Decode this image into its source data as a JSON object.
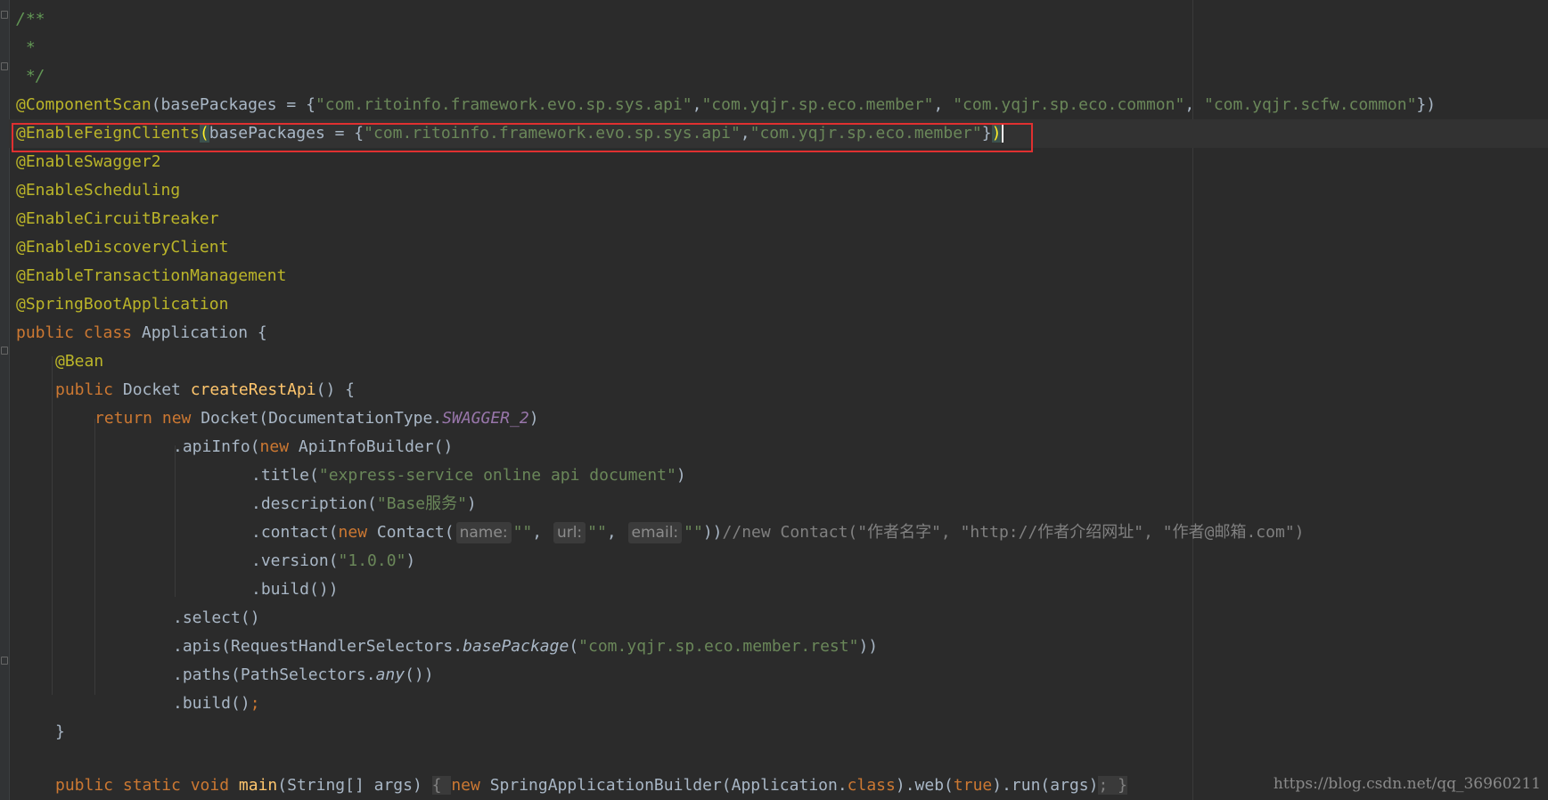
{
  "editor": {
    "watermark": "https://blog.csdn.net/qq_36960211"
  },
  "code": {
    "l1": "/**",
    "l2": " *",
    "l3": " */",
    "l4_anno": "@ComponentScan",
    "l4_open": "(basePackages = {",
    "l4_s1": "\"com.ritoinfo.framework.evo.sp.sys.api\"",
    "l4_s2": "\"com.yqjr.sp.eco.member\"",
    "l4_s3": "\"com.yqjr.sp.eco.common\"",
    "l4_s4": "\"com.yqjr.scfw.common\"",
    "l4_close": "})",
    "l5_anno": "@EnableFeignClients",
    "l5_paren": "(",
    "l5_mid": "basePackages = {",
    "l5_s1": "\"com.ritoinfo.framework.evo.sp.sys.api\"",
    "l5_s2": "\"com.yqjr.sp.eco.member\"",
    "l5_brace": "}",
    "l5_close": ")",
    "l6": "@EnableSwagger2",
    "l7": "@EnableScheduling",
    "l8": "@EnableCircuitBreaker",
    "l9": "@EnableDiscoveryClient",
    "l10": "@EnableTransactionManagement",
    "l11": "@SpringBootApplication",
    "l12_kw": "public class ",
    "l12_name": "Application {",
    "l13": "@Bean",
    "l14_kw": "public ",
    "l14_type": "Docket ",
    "l14_fn": "createRestApi",
    "l14_rest": "() {",
    "l15_kw": "return new ",
    "l15_type": "Docket(DocumentationType.",
    "l15_const": "SWAGGER_2",
    "l15_end": ")",
    "l16_a": ".apiInfo(",
    "l16_kw": "new ",
    "l16_b": "ApiInfoBuilder()",
    "l17_a": ".title(",
    "l17_s": "\"express-service online api document\"",
    "l17_b": ")",
    "l18_a": ".description(",
    "l18_s": "\"Base服务\"",
    "l18_b": ")",
    "l19_a": ".contact(",
    "l19_kw": "new ",
    "l19_b": "Contact(",
    "l19_hint_name": "name:",
    "l19_hint_url": "url:",
    "l19_hint_email": "email:",
    "l19_empty": "\"\"",
    "l19_comma": ", ",
    "l19_close": "))",
    "l19_comment": "//new Contact(\"作者名字\", \"http://作者介绍网址\", \"作者@邮箱.com\")",
    "l20_a": ".version(",
    "l20_s": "\"1.0.0\"",
    "l20_b": ")",
    "l21": ".build())",
    "l22": ".select()",
    "l23_a": ".apis(RequestHandlerSelectors.",
    "l23_i": "basePackage",
    "l23_p": "(",
    "l23_s": "\"com.yqjr.sp.eco.member.rest\"",
    "l23_b": "))",
    "l24_a": ".paths(PathSelectors.",
    "l24_i": "any",
    "l24_b": "())",
    "l25_a": ".build()",
    "l25_semi": ";",
    "l26": "}",
    "l28_kw": "public static void ",
    "l28_fn": "main",
    "l28_a": "(String[] args) ",
    "l28_brace_open": "{ ",
    "l28_kw2": "new ",
    "l28_b": "SpringApplicationBuilder(Application.",
    "l28_kw3": "class",
    "l28_c": ").web(",
    "l28_kw4": "true",
    "l28_d": ").run(args)",
    "l28_semi": "; ",
    "l28_brace_close": "}"
  }
}
